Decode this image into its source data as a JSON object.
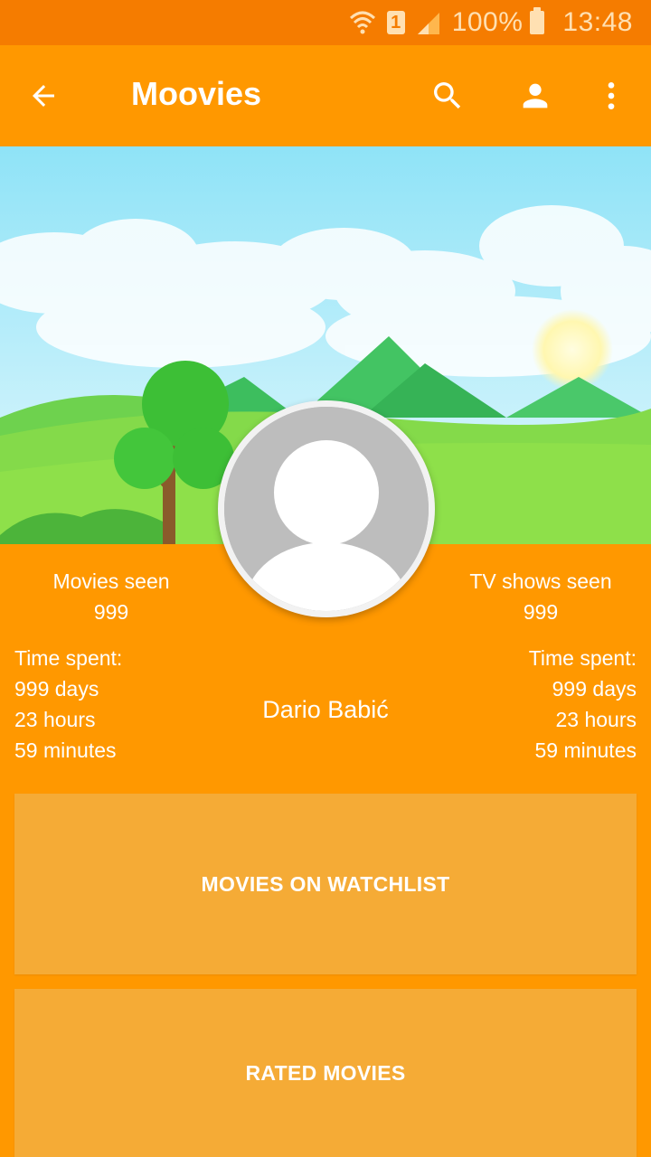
{
  "status_bar": {
    "sim": "1",
    "battery": "100%",
    "time": "13:48"
  },
  "app_bar": {
    "title": "Moovies",
    "icons": [
      "back-arrow-icon",
      "search-icon",
      "account-icon",
      "more-vert-icon"
    ]
  },
  "profile": {
    "name": "Dario Babić",
    "movies_seen_label": "Movies seen",
    "movies_seen_value": "999",
    "tv_seen_label": "TV shows seen",
    "tv_seen_value": "999",
    "movies_time": {
      "label": "Time spent:",
      "days": "999 days",
      "hours": "23 hours",
      "minutes": "59 minutes"
    },
    "tv_time": {
      "label": "Time spent:",
      "days": "999 days",
      "hours": "23 hours",
      "minutes": "59 minutes"
    }
  },
  "cards": {
    "watchlist": "MOVIES ON WATCHLIST",
    "rated": "RATED MOVIES"
  },
  "colors": {
    "primary": "#FF9800",
    "status_bar": "#F57C00",
    "card": "#F5AB36"
  }
}
